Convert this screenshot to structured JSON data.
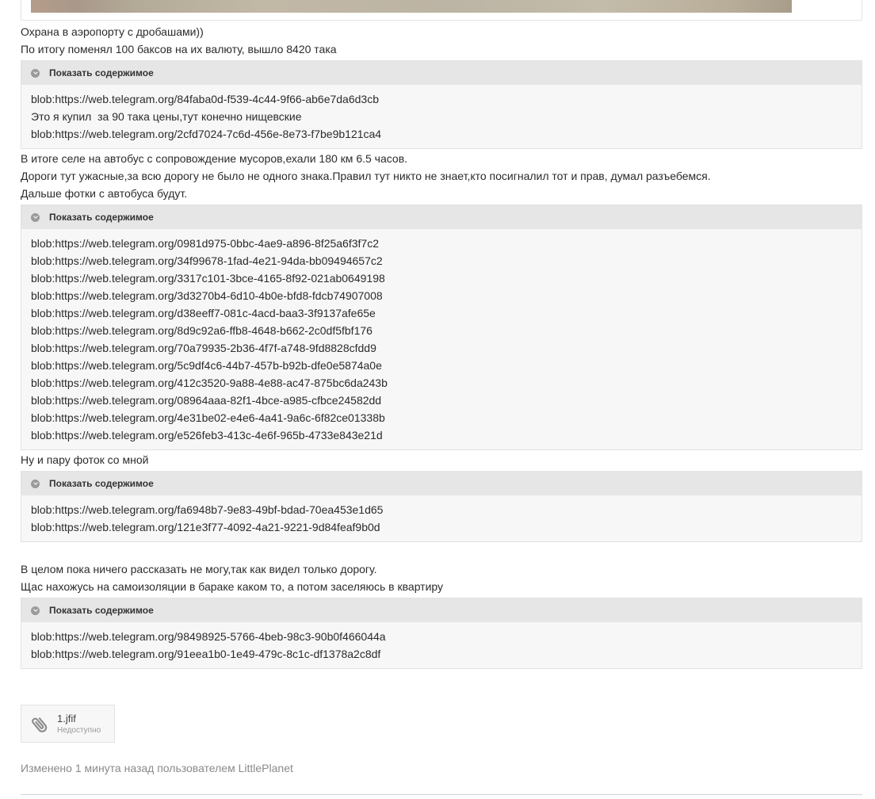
{
  "text_1": [
    "Охрана в аэропорту с дробашами))",
    "По итогу поменял 100 баксов на их валюту, вышло 8420 така"
  ],
  "spoiler_1": {
    "label": "Показать содержимое",
    "lines": [
      "blob:https://web.telegram.org/84faba0d-f539-4c44-9f66-ab6e7da6d3cb",
      "Это я купил  за 90 така цены,тут конечно нищевские",
      "blob:https://web.telegram.org/2cfd7024-7c6d-456e-8e73-f7be9b121ca4"
    ]
  },
  "text_2": [
    "В итоге селе на автобус с сопровождение мусоров,ехали 180 км 6.5 часов.",
    "Дороги тут ужасные,за всю дорогу не было не одного знака.Правил тут никто не знает,кто посигналил тот и прав, думал разъебемся.",
    "Дальше фотки с автобуса будут."
  ],
  "spoiler_2": {
    "label": "Показать содержимое",
    "lines": [
      "blob:https://web.telegram.org/0981d975-0bbc-4ae9-a896-8f25a6f3f7c2",
      "blob:https://web.telegram.org/34f99678-1fad-4e21-94da-bb09494657c2",
      "blob:https://web.telegram.org/3317c101-3bce-4165-8f92-021ab0649198",
      "blob:https://web.telegram.org/3d3270b4-6d10-4b0e-bfd8-fdcb74907008",
      "blob:https://web.telegram.org/d38eeff7-081c-4acd-baa3-3f9137afe65e",
      "blob:https://web.telegram.org/8d9c92a6-ffb8-4648-b662-2c0df5fbf176",
      "blob:https://web.telegram.org/70a79935-2b36-4f7f-a748-9fd8828cfdd9",
      "blob:https://web.telegram.org/5c9df4c6-44b7-457b-b92b-dfe0e5874a0e",
      "blob:https://web.telegram.org/412c3520-9a88-4e88-ac47-875bc6da243b",
      "blob:https://web.telegram.org/08964aaa-82f1-4bce-a985-cfbce24582dd",
      "blob:https://web.telegram.org/4e31be02-e4e6-4a41-9a6c-6f82ce01338b",
      "blob:https://web.telegram.org/e526feb3-413c-4e6f-965b-4733e843e21d"
    ]
  },
  "text_3": [
    "Ну и пару фоток со мной"
  ],
  "spoiler_3": {
    "label": "Показать содержимое",
    "lines": [
      "blob:https://web.telegram.org/fa6948b7-9e83-49bf-bdad-70ea453e1d65",
      "blob:https://web.telegram.org/121e3f77-4092-4a21-9221-9d84feaf9b0d"
    ]
  },
  "text_4": [
    "В целом пока ничего рассказать не могу,так как видел только дорогу.",
    "Щас нахожусь на самоизоляции в бараке каком то, а потом заселяюсь в квартиру"
  ],
  "spoiler_4": {
    "label": "Показать содержимое",
    "lines": [
      "blob:https://web.telegram.org/98498925-5766-4beb-98c3-90b0f466044a",
      "blob:https://web.telegram.org/91eea1b0-1e49-479c-8c1c-df1378a2c8df"
    ]
  },
  "attachment": {
    "name": "1.jfif",
    "status": "Недоступно",
    "icon": "paperclip-icon"
  },
  "edited": "Изменено 1 минута назад пользователем LittlePlanet"
}
